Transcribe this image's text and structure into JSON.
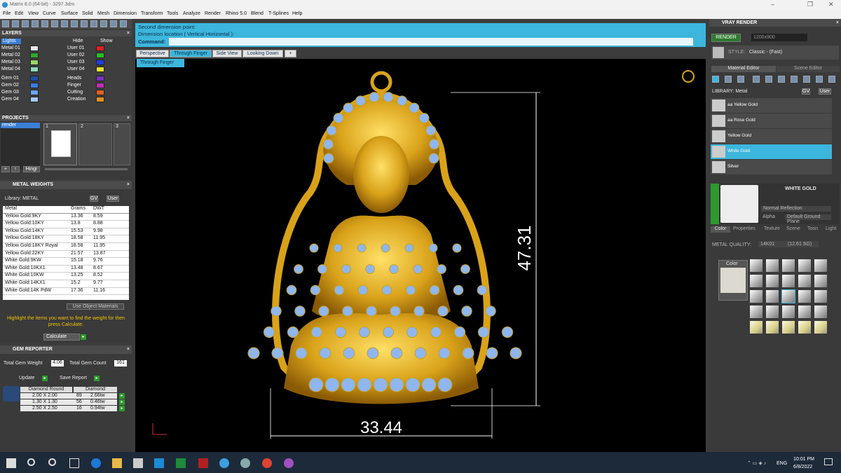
{
  "titlebar": {
    "title": "Matrix 8.0 (64-bit) - 3297.3dm",
    "minimize": "–",
    "maximize": "❐",
    "close": "✕"
  },
  "menu": [
    "File",
    "Edit",
    "View",
    "Curve",
    "Surface",
    "Solid",
    "Mesh",
    "Dimension",
    "Transform",
    "Tools",
    "Analyze",
    "Render",
    "Rhino 5.0",
    "Blend",
    "T-Splines",
    "Help"
  ],
  "layers": {
    "title": "LAYERS",
    "lights": "Lights",
    "hide": "Hide",
    "show": "Show",
    "left": [
      "Metal 01",
      "Metal 02",
      "Metal 03",
      "Metal 04",
      "Gem 01",
      "Gem 02",
      "Gem 03",
      "Gem 04"
    ],
    "right": [
      "User 01",
      "User 02",
      "User 03",
      "User 04",
      "Heads",
      "Finger",
      "Cutting",
      "Creation"
    ],
    "left_colors": [
      "#e8e8e8",
      "#2ea82e",
      "#9ad36a",
      "#8fd9ba",
      "#1f4fa0",
      "#3a7be0",
      "#6aa6ff",
      "#a8c8ff"
    ],
    "right_colors": [
      "#e02020",
      "#25c025",
      "#2040e0",
      "#e8e030",
      "#7a30c0",
      "#c030b0",
      "#e06020",
      "#e09020"
    ]
  },
  "projects": {
    "title": "PROJECTS",
    "item": "render",
    "tabs": [
      "1",
      "2",
      "3"
    ],
    "hinge": "Hingr"
  },
  "metal_weights": {
    "title": "METAL WEIGHTS",
    "library_label": "Library: METAL",
    "lib_btn1": "GV",
    "lib_btn2": "User",
    "headers": [
      "Metal",
      "Grams",
      "DWT"
    ],
    "rows": [
      [
        "Yellow Gold:9KY",
        "13.36",
        "8.59"
      ],
      [
        "Yellow Gold:10KY",
        "13.8",
        "8.88"
      ],
      [
        "Yellow Gold:14KY",
        "15.53",
        "9.98"
      ],
      [
        "Yellow Gold:18KY",
        "18.58",
        "11.95"
      ],
      [
        "Yellow Gold:18KY Royal",
        "18.58",
        "11.95"
      ],
      [
        "Yellow Gold:22KY",
        "21.57",
        "13.87"
      ],
      [
        "White Gold:9KW",
        "15.18",
        "9.76"
      ],
      [
        "White Gold:10KX1",
        "13.48",
        "8.67"
      ],
      [
        "White Gold:10KW",
        "13.25",
        "8.52"
      ],
      [
        "White Gold:14KX1",
        "15.2",
        "9.77"
      ],
      [
        "White Gold:14K PdW",
        "17.36",
        "11.16"
      ]
    ],
    "use_object": "Use Object Materials",
    "hint": "Highlight the items you want to find the weight for then press Calculate.",
    "calculate": "Calculate"
  },
  "gem_reporter": {
    "title": "GEM REPORTER",
    "total_weight_label": "Total Gem Weight",
    "total_weight": "4.06",
    "total_count_label": "Total Gem Count",
    "total_count": "161",
    "update": "Update",
    "save": "Save Report",
    "headers": [
      "Diamond Round",
      "Diamond"
    ],
    "rows": [
      [
        "2.00 X 2.00",
        "89",
        "2.66tw"
      ],
      [
        "1.30 X 1.30",
        "56",
        "0.46tw"
      ],
      [
        "2.50 X 2.50",
        "16",
        "0.94tw"
      ]
    ]
  },
  "command": {
    "line1": "Second dimension point:",
    "line2": "Dimension location ( Vertical  Horizontal ):",
    "prompt": "Command:"
  },
  "viewtabs": [
    "Perspective",
    "Through Finger",
    "Side View",
    "Looking Down",
    "+"
  ],
  "viewport": {
    "label": "Through Finger",
    "dim_vertical": "47.31",
    "dim_horizontal": "33.44"
  },
  "vray": {
    "title": "VRAY RENDER",
    "render": "RENDER",
    "resolution": "1200x900",
    "style_label": "STYLE:",
    "style": "Classic - (Fast)",
    "tabs": [
      "Material Editor",
      "Scene Editor"
    ],
    "library": "LIBRARY: Metal",
    "lib_btn1": "GV",
    "lib_btn2": "User",
    "materials": [
      "aa Yellow Gold",
      "aa Rose Gold",
      "Yellow Gold",
      "White Gold",
      "Silver"
    ],
    "selected_material": "WHITE GOLD",
    "reflection": "Normal Reflection",
    "alpha": "Alpha",
    "ground": "Default Ground Plane",
    "subtabs": [
      "Color",
      "Properties",
      "Texture",
      "Scene",
      "Toon",
      "Light"
    ],
    "metal_quality_label": "METAL QUALITY:",
    "metal_quality": "14K01",
    "metal_quality_value": "(12.61 SG)",
    "color_label": "Color"
  },
  "taskbar": {
    "lang": "ENG",
    "time": "10:01 PM",
    "date": "6/8/2022"
  }
}
